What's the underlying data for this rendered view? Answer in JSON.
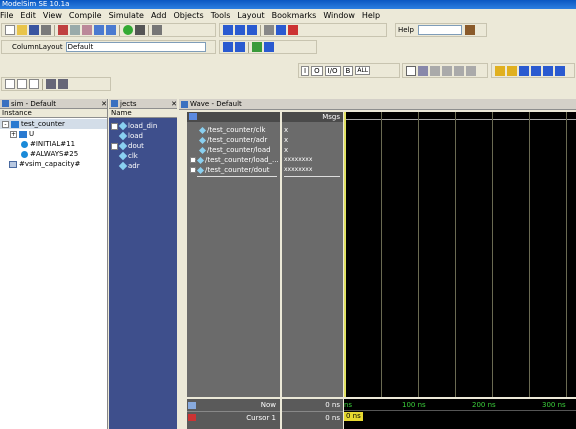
{
  "window": {
    "title": "ModelSim SE 10.1a"
  },
  "menu": [
    "File",
    "Edit",
    "View",
    "Compile",
    "Simulate",
    "Add",
    "Objects",
    "Tools",
    "Layout",
    "Bookmarks",
    "Window",
    "Help"
  ],
  "toolbar": {
    "help_label": "Help",
    "column_layout_label": "ColumnLayout",
    "column_layout_value": "Default",
    "format_buttons": [
      "I",
      "O",
      "I/O",
      "B",
      "ALL"
    ]
  },
  "sim_panel": {
    "tab": "sim - Default",
    "column_header": "Instance",
    "items": [
      {
        "label": "test_counter",
        "level": 0,
        "expander": "-"
      },
      {
        "label": "U",
        "level": 1,
        "expander": "+"
      },
      {
        "label": "#INITIAL#11",
        "level": 1,
        "expander": ""
      },
      {
        "label": "#ALWAYS#25",
        "level": 1,
        "expander": ""
      },
      {
        "label": "#vsim_capacity#",
        "level": 0,
        "expander": ""
      }
    ]
  },
  "objects_panel": {
    "tab": "jects",
    "column_header": "Name",
    "items": [
      {
        "label": "load_din",
        "expander": "+"
      },
      {
        "label": "load",
        "expander": ""
      },
      {
        "label": "dout",
        "expander": "+"
      },
      {
        "label": "clk",
        "expander": ""
      },
      {
        "label": "adr",
        "expander": ""
      }
    ]
  },
  "wave_panel": {
    "tab": "Wave - Default",
    "msgs_header": "Msgs",
    "signals": [
      {
        "name": "/test_counter/clk",
        "value": "x",
        "expander": ""
      },
      {
        "name": "/test_counter/adr",
        "value": "x",
        "expander": ""
      },
      {
        "name": "/test_counter/load",
        "value": "x",
        "expander": ""
      },
      {
        "name": "/test_counter/load_...",
        "value": "xxxxxxxx",
        "expander": "+"
      },
      {
        "name": "/test_counter/dout",
        "value": "xxxxxxxx",
        "expander": "+"
      }
    ],
    "now_label": "Now",
    "now_value": "0 ns",
    "cursor_label": "Cursor 1",
    "cursor_value": "0 ns",
    "cursor_marker": "0 ns",
    "timeline_ticks": [
      "100 ns",
      "200 ns",
      "300 ns"
    ],
    "timeline_start": "ns"
  }
}
